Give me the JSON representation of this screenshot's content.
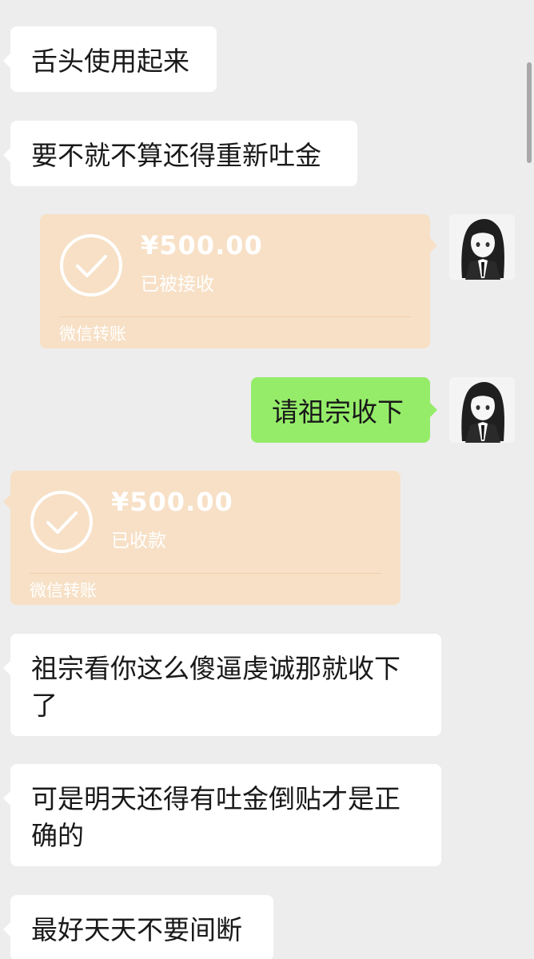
{
  "messages": [
    {
      "type": "text",
      "side": "in",
      "text": "舌头使用起来"
    },
    {
      "type": "text",
      "side": "in",
      "text": "要不就不算还得重新吐金"
    },
    {
      "type": "transfer",
      "side": "out",
      "amount": "¥500.00",
      "status": "已被接收",
      "brand": "微信转账"
    },
    {
      "type": "text",
      "side": "out",
      "text": "请祖宗收下"
    },
    {
      "type": "transfer",
      "side": "in",
      "amount": "¥500.00",
      "status": "已收款",
      "brand": "微信转账"
    },
    {
      "type": "text",
      "side": "in",
      "text": "祖宗看你这么傻逼虔诚那就收下了"
    },
    {
      "type": "text",
      "side": "in",
      "text": "可是明天还得有吐金倒贴才是正确的"
    },
    {
      "type": "text",
      "side": "in",
      "text": "最好天天不要间断"
    }
  ],
  "colors": {
    "background": "#ededed",
    "incoming_bubble": "#ffffff",
    "outgoing_bubble": "#95ec69",
    "transfer_card": "#f7e0c6"
  },
  "icons": {
    "transfer_status": "check-circle-icon",
    "avatar": "anime-girl-avatar"
  }
}
